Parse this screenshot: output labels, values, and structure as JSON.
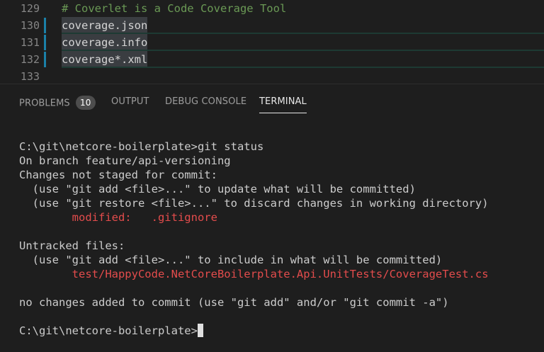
{
  "editor": {
    "lines": [
      {
        "number": "129",
        "text": "# Coverlet is a Code Coverage Tool"
      },
      {
        "number": "130",
        "text": "coverage.json"
      },
      {
        "number": "131",
        "text": "coverage.info"
      },
      {
        "number": "132",
        "text": "coverage*.xml"
      },
      {
        "number": "133",
        "text": ""
      }
    ]
  },
  "panel": {
    "tabs": {
      "problems": "PROBLEMS",
      "problems_count": "10",
      "output": "OUTPUT",
      "debug_console": "DEBUG CONSOLE",
      "terminal": "TERMINAL"
    },
    "active_tab": "TERMINAL"
  },
  "terminal": {
    "lines": [
      "C:\\git\\netcore-boilerplate>git status",
      "On branch feature/api-versioning",
      "Changes not staged for commit:",
      "  (use \"git add <file>...\" to update what will be committed)",
      "  (use \"git restore <file>...\" to discard changes in working directory)",
      "        modified:   .gitignore",
      "",
      "Untracked files:",
      "  (use \"git add <file>...\" to include in what will be committed)",
      "        test/HappyCode.NetCoreBoilerplate.Api.UnitTests/CoverageTest.cs",
      "",
      "no changes added to commit (use \"git add\" and/or \"git commit -a\")",
      "",
      "C:\\git\\netcore-boilerplate>"
    ]
  },
  "colors": {
    "background": "#1e1e1e",
    "comment": "#6a9955",
    "error_red": "#e34c4c",
    "gutter_modified": "#1b81a8"
  }
}
